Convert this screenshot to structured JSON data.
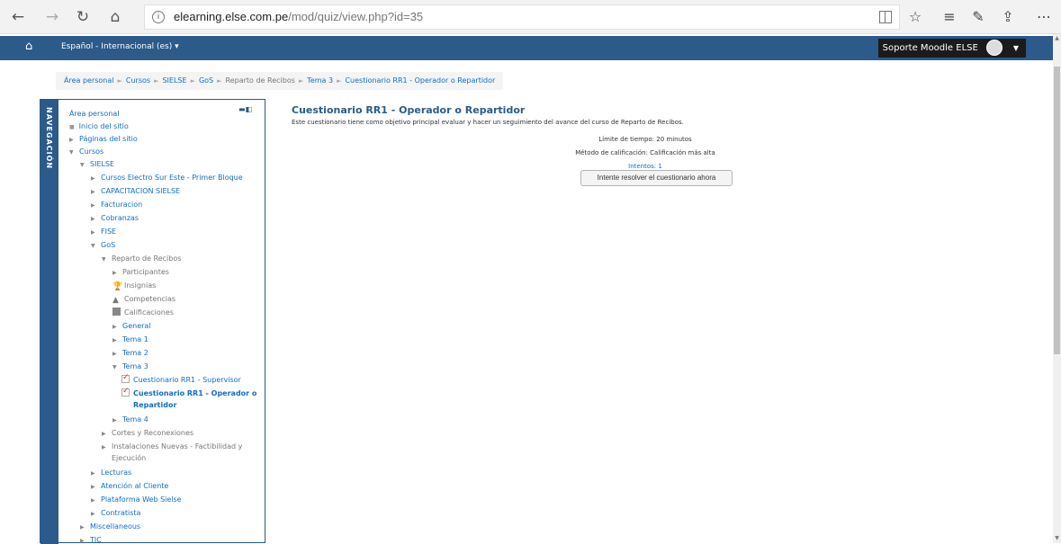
{
  "browser": {
    "url_domain": "elearning.else.com.pe",
    "url_path": "/mod/quiz/view.php?id=35"
  },
  "navbar": {
    "language": "Español - Internacional (es) ▾",
    "user_name": "Soporte Moodle ELSE"
  },
  "breadcrumb": [
    "Área personal",
    "Cursos",
    "SIELSE",
    "GoS",
    "Reparto de Recibos",
    "Tema 3",
    "Cuestionario RR1 - Operador o Repartidor"
  ],
  "nav_block": {
    "tab_label": "NAVEGACIÓN",
    "items": [
      "Área personal",
      "Inicio del sitio",
      "Páginas del sitio",
      "Cursos",
      "SIELSE",
      "Cursos Electro Sur Este - Primer Bloque",
      "CAPACITACION SIELSE",
      "Facturacion",
      "Cobranzas",
      "FISE",
      "GoS",
      "Reparto de Recibos",
      "Participantes",
      "Insignias",
      "Competencias",
      "Calificaciones",
      "General",
      "Tema 1",
      "Tema 2",
      "Tema 3",
      "Cuestionario RR1 - Supervisor",
      "Cuestionario RR1 - Operador o",
      "Repartidor",
      "Tema 4",
      "Cortes y Reconexiones",
      "Instalaciones Nuevas - Factibilidad y",
      "Ejecución",
      "Lecturas",
      "Atención al Cliente",
      "Plataforma Web Sielse",
      "Contratista",
      "Miscellaneous",
      "TIC"
    ]
  },
  "main": {
    "title": "Cuestionario RR1 - Operador o Repartidor",
    "intro": "Este cuestionario tiene como objetivo principal evaluar y hacer un seguimiento del avance del curso de Reparto de Recibos.",
    "time_limit": "Límite de tiempo: 20 minutos",
    "grading_method": "Método de calificación: Calificación más alta",
    "attempts": "Intentos: 1",
    "attempt_button": "Intente resolver el cuestionario ahora"
  }
}
